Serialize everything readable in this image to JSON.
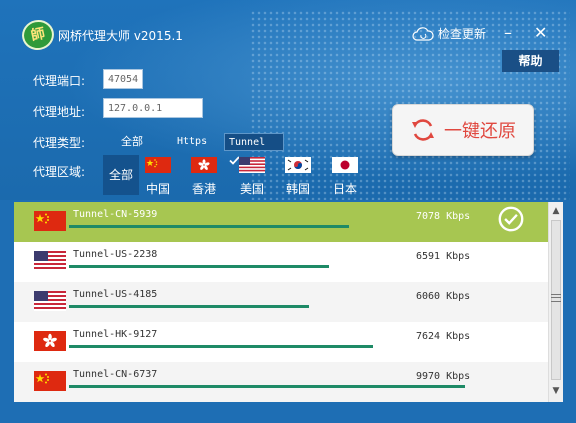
{
  "app": {
    "logo_char": "師",
    "title": "网桥代理大师 v2015.1",
    "check_update": "检查更新",
    "minimize": "–",
    "close": "✕",
    "help": "帮助"
  },
  "form": {
    "port_label": "代理端口:",
    "port_value": "47054",
    "address_label": "代理地址:",
    "address_value": "127.0.0.1",
    "type_label": "代理类型:",
    "type_options": [
      "全部",
      "Https",
      "Tunnel"
    ],
    "type_selected": "Tunnel",
    "region_label": "代理区域:",
    "region_all": "全部",
    "regions": [
      "中国",
      "香港",
      "美国",
      "韩国",
      "日本"
    ]
  },
  "one_click": {
    "label": "一键还原"
  },
  "colors": {
    "accent": "#a7c651",
    "bar": "#1e8a66",
    "button_text": "#e0483f"
  },
  "servers": [
    {
      "name": "Tunnel-CN-5939",
      "speed": "7078 Kbps",
      "flag": "cn-flag-icon",
      "selected": true
    },
    {
      "name": "Tunnel-US-2238",
      "speed": "6591 Kbps",
      "flag": "us-flag-icon",
      "selected": false
    },
    {
      "name": "Tunnel-US-4185",
      "speed": "6060 Kbps",
      "flag": "us-flag-icon",
      "selected": false
    },
    {
      "name": "Tunnel-HK-9127",
      "speed": "7624 Kbps",
      "flag": "hk-flag-icon",
      "selected": false
    },
    {
      "name": "Tunnel-CN-6737",
      "speed": "9970 Kbps",
      "flag": "cn-flag-icon",
      "selected": false
    }
  ]
}
